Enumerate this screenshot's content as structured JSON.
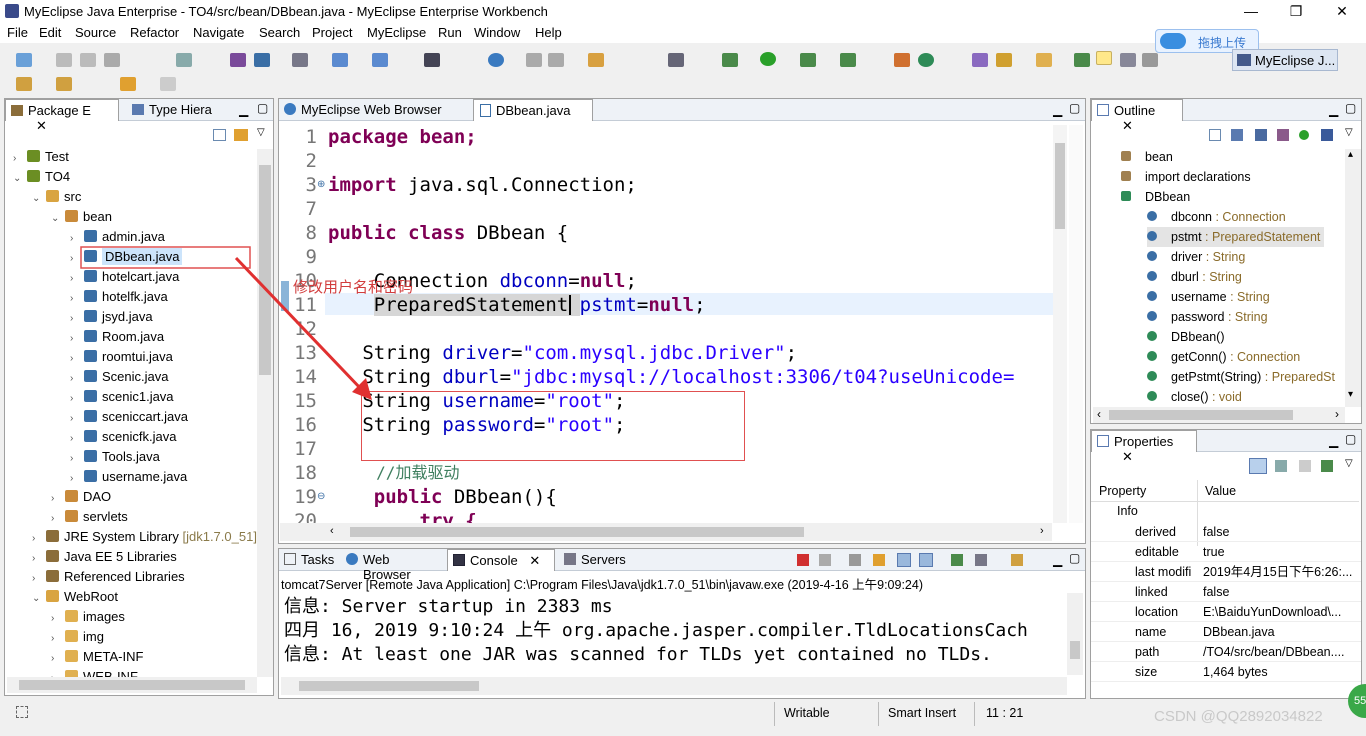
{
  "window": {
    "title": "MyEclipse Java Enterprise - TO4/src/bean/DBbean.java - MyEclipse Enterprise Workbench",
    "min": "—",
    "max": "❐",
    "close": "✕"
  },
  "menu": [
    "File",
    "Edit",
    "Source",
    "Refactor",
    "Navigate",
    "Search",
    "Project",
    "MyEclipse",
    "Run",
    "Window",
    "Help"
  ],
  "upload_badge": "拖拽上传",
  "perspective": "MyEclipse J...",
  "left_tabs": {
    "package": "Package E",
    "type": "Type Hiera"
  },
  "tree": [
    {
      "label": "Test",
      "indent": 0,
      "arrow": "›",
      "icon": "#6b8e23"
    },
    {
      "label": "TO4",
      "indent": 0,
      "arrow": "⌄",
      "icon": "#6b8e23"
    },
    {
      "label": "src",
      "indent": 1,
      "arrow": "⌄",
      "icon": "#d9a441"
    },
    {
      "label": "bean",
      "indent": 2,
      "arrow": "⌄",
      "icon": "#c98a3a"
    },
    {
      "label": "admin.java",
      "indent": 3,
      "arrow": "›",
      "icon": "#3a6ea5"
    },
    {
      "label": "DBbean.java",
      "indent": 3,
      "arrow": "›",
      "icon": "#3a6ea5",
      "selected": true
    },
    {
      "label": "hotelcart.java",
      "indent": 3,
      "arrow": "›",
      "icon": "#3a6ea5"
    },
    {
      "label": "hotelfk.java",
      "indent": 3,
      "arrow": "›",
      "icon": "#3a6ea5"
    },
    {
      "label": "jsyd.java",
      "indent": 3,
      "arrow": "›",
      "icon": "#3a6ea5"
    },
    {
      "label": "Room.java",
      "indent": 3,
      "arrow": "›",
      "icon": "#3a6ea5"
    },
    {
      "label": "roomtui.java",
      "indent": 3,
      "arrow": "›",
      "icon": "#3a6ea5"
    },
    {
      "label": "Scenic.java",
      "indent": 3,
      "arrow": "›",
      "icon": "#3a6ea5"
    },
    {
      "label": "scenic1.java",
      "indent": 3,
      "arrow": "›",
      "icon": "#3a6ea5"
    },
    {
      "label": "sceniccart.java",
      "indent": 3,
      "arrow": "›",
      "icon": "#3a6ea5"
    },
    {
      "label": "scenicfk.java",
      "indent": 3,
      "arrow": "›",
      "icon": "#3a6ea5"
    },
    {
      "label": "Tools.java",
      "indent": 3,
      "arrow": "›",
      "icon": "#3a6ea5"
    },
    {
      "label": "username.java",
      "indent": 3,
      "arrow": "›",
      "icon": "#3a6ea5"
    },
    {
      "label": "DAO",
      "indent": 2,
      "arrow": "›",
      "icon": "#c98a3a"
    },
    {
      "label": "servlets",
      "indent": 2,
      "arrow": "›",
      "icon": "#c98a3a"
    },
    {
      "label": "JRE System Library",
      "suffix": " [jdk1.7.0_51]",
      "indent": 1,
      "arrow": "›",
      "icon": "#8b6d3a"
    },
    {
      "label": "Java EE 5 Libraries",
      "indent": 1,
      "arrow": "›",
      "icon": "#8b6d3a"
    },
    {
      "label": "Referenced Libraries",
      "indent": 1,
      "arrow": "›",
      "icon": "#8b6d3a"
    },
    {
      "label": "WebRoot",
      "indent": 1,
      "arrow": "⌄",
      "icon": "#d9a441"
    },
    {
      "label": "images",
      "indent": 2,
      "arrow": "›",
      "icon": "#e0b050"
    },
    {
      "label": "img",
      "indent": 2,
      "arrow": "›",
      "icon": "#e0b050"
    },
    {
      "label": "META-INF",
      "indent": 2,
      "arrow": "›",
      "icon": "#e0b050"
    },
    {
      "label": "WEB-INF",
      "indent": 2,
      "arrow": "›",
      "icon": "#e0b050"
    }
  ],
  "editor_tabs": {
    "browser": "MyEclipse Web Browser",
    "file": "DBbean.java"
  },
  "line_numbers": [
    "1",
    "2",
    "3",
    "7",
    "8",
    "9",
    "10",
    "11",
    "12",
    "13",
    "14",
    "15",
    "16",
    "17",
    "18",
    "19",
    "20"
  ],
  "code": {
    "l1": "package bean;",
    "l3": "import java.sql.Connection;",
    "l8": "public class DBbean {",
    "l10a": "Connection ",
    "l10b": "dbconn",
    "l10c": "=null;",
    "l11a": "PreparedStatement ",
    "l11b": "pstmt",
    "l11c": "=null;",
    "l13a": "String ",
    "l13b": "driver",
    "l13c": "=",
    "l13d": "\"com.mysql.jdbc.Driver\"",
    "l13e": ";",
    "l14a": "String ",
    "l14b": "dburl",
    "l14c": "=",
    "l14d": "\"jdbc:mysql://localhost:3306/t04?useUnicode=",
    "l15a": "String ",
    "l15b": "username",
    "l15c": "=",
    "l15d": "\"root\"",
    "l15e": ";",
    "l16a": "String ",
    "l16b": "password",
    "l16c": "=",
    "l16d": "\"root\"",
    "l16e": ";",
    "l18": "//加载驱动",
    "l19a": "public ",
    "l19b": "DBbean(){",
    "l20": "try {"
  },
  "annotation": "修改用户名和密码",
  "bottom_tabs": {
    "tasks": "Tasks",
    "browser": "Web Browser",
    "console": "Console",
    "servers": "Servers"
  },
  "console_header": "tomcat7Server [Remote Java Application] C:\\Program Files\\Java\\jdk1.7.0_51\\bin\\javaw.exe (2019-4-16 上午9:09:24)",
  "console_lines": [
    "信息: Server startup in 2383 ms",
    "四月 16, 2019 9:10:24 上午 org.apache.jasper.compiler.TldLocationsCach",
    "信息: At least one JAR was scanned for TLDs yet contained no TLDs. "
  ],
  "outline": {
    "title": "Outline",
    "items": [
      {
        "label": "bean",
        "type": "",
        "indent": 0,
        "color": "#a08050"
      },
      {
        "label": "import declarations",
        "type": "",
        "indent": 0,
        "color": "#a08050"
      },
      {
        "label": "DBbean",
        "type": "",
        "indent": 0,
        "color": "#2e8b57"
      },
      {
        "label": "dbconn",
        "type": " : Connection",
        "indent": 1,
        "color": "#3a6ea5"
      },
      {
        "label": "pstmt",
        "type": " : PreparedStatement",
        "indent": 1,
        "color": "#3a6ea5",
        "selected": true
      },
      {
        "label": "driver",
        "type": " : String",
        "indent": 1,
        "color": "#3a6ea5"
      },
      {
        "label": "dburl",
        "type": " : String",
        "indent": 1,
        "color": "#3a6ea5"
      },
      {
        "label": "username",
        "type": " : String",
        "indent": 1,
        "color": "#3a6ea5"
      },
      {
        "label": "password",
        "type": " : String",
        "indent": 1,
        "color": "#3a6ea5"
      },
      {
        "label": "DBbean()",
        "type": "",
        "indent": 1,
        "color": "#2e8b57"
      },
      {
        "label": "getConn()",
        "type": " : Connection",
        "indent": 1,
        "color": "#2e8b57"
      },
      {
        "label": "getPstmt(String)",
        "type": " : PreparedSt",
        "indent": 1,
        "color": "#2e8b57"
      },
      {
        "label": "close()",
        "type": " : void",
        "indent": 1,
        "color": "#2e8b57"
      }
    ]
  },
  "properties": {
    "title": "Properties",
    "col_property": "Property",
    "col_value": "Value",
    "group": "Info",
    "rows": [
      {
        "k": "derived",
        "v": "false"
      },
      {
        "k": "editable",
        "v": "true"
      },
      {
        "k": "last modifi",
        "v": "2019年4月15日下午6:26:..."
      },
      {
        "k": "linked",
        "v": "false"
      },
      {
        "k": "location",
        "v": "E:\\BaiduYunDownload\\..."
      },
      {
        "k": "name",
        "v": "DBbean.java"
      },
      {
        "k": "path",
        "v": "/TO4/src/bean/DBbean...."
      },
      {
        "k": "size",
        "v": "1,464  bytes"
      }
    ]
  },
  "status": {
    "writable": "Writable",
    "insert": "Smart Insert",
    "pos": "11 : 21",
    "watermark": "CSDN @QQ2892034822",
    "badge": "55"
  }
}
